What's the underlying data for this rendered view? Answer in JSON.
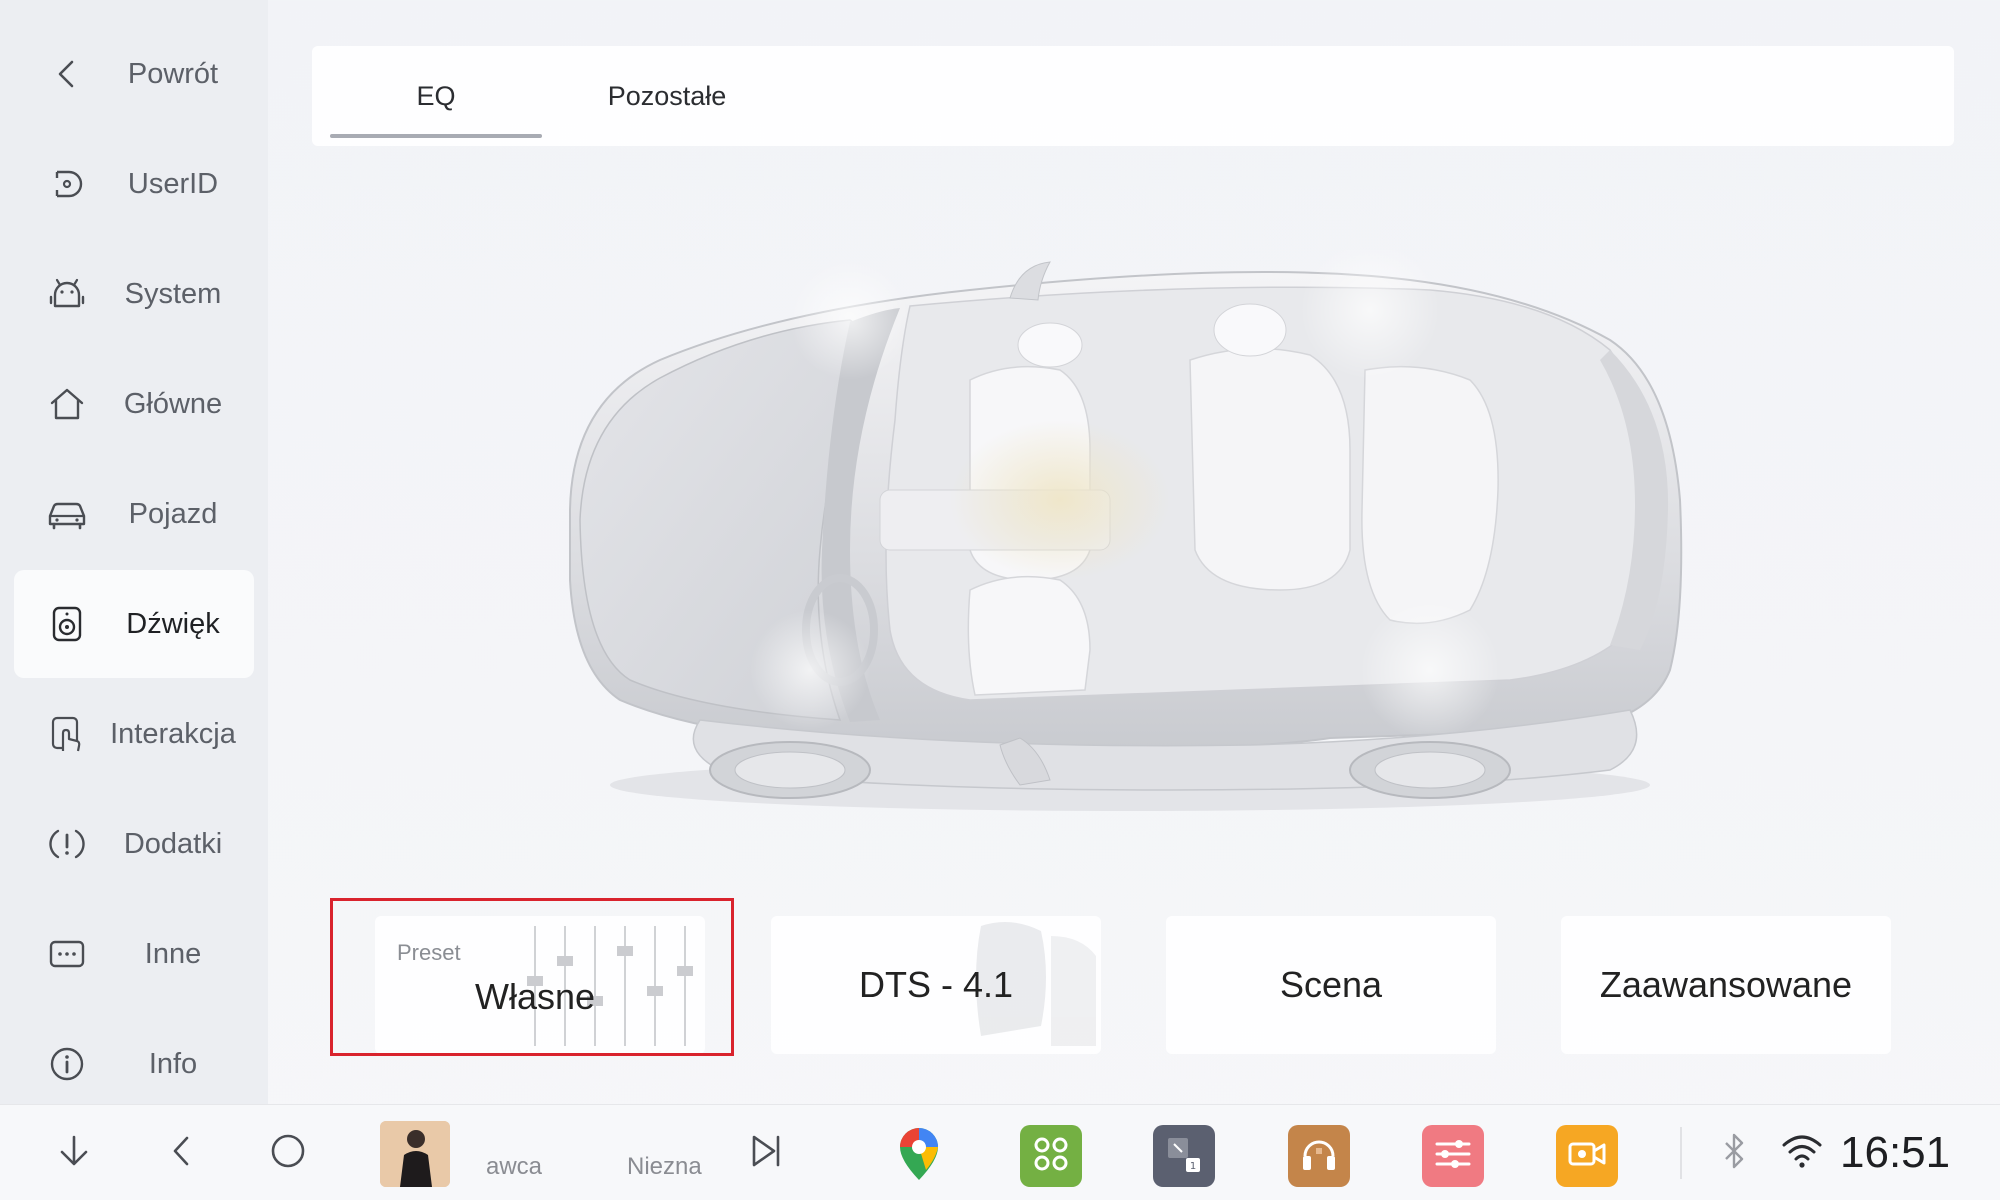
{
  "sidebar": {
    "items": [
      {
        "label": "Powrót",
        "icon": "chevron-left-icon"
      },
      {
        "label": "UserID",
        "icon": "user-id-icon"
      },
      {
        "label": "System",
        "icon": "android-icon"
      },
      {
        "label": "Główne",
        "icon": "home-icon"
      },
      {
        "label": "Pojazd",
        "icon": "car-icon"
      },
      {
        "label": "Dźwięk",
        "icon": "speaker-icon",
        "active": true
      },
      {
        "label": "Interakcja",
        "icon": "touch-icon"
      },
      {
        "label": "Dodatki",
        "icon": "alert-icon"
      },
      {
        "label": "Inne",
        "icon": "more-icon"
      },
      {
        "label": "Info",
        "icon": "info-icon"
      }
    ]
  },
  "tabs": {
    "eq": "EQ",
    "other": "Pozostałe",
    "active": "EQ"
  },
  "cards": {
    "preset_caption": "Preset",
    "preset_value": "Własne",
    "dts": "DTS - 4.1",
    "scene": "Scena",
    "advanced": "Zaawansowane"
  },
  "bottombar": {
    "artist": "awca",
    "title": "Niezna",
    "clock": "16:51",
    "apps": [
      "maps-icon",
      "apps-grid-icon",
      "multiwindow-icon",
      "radio-icon",
      "equalizer-icon",
      "dashcam-icon"
    ]
  },
  "colors": {
    "selection": "#d9232d",
    "app_green": "#74b043",
    "app_slate": "#5b6070",
    "app_brown": "#c4854a",
    "app_pink": "#f07a82",
    "app_orange": "#f6a723"
  }
}
